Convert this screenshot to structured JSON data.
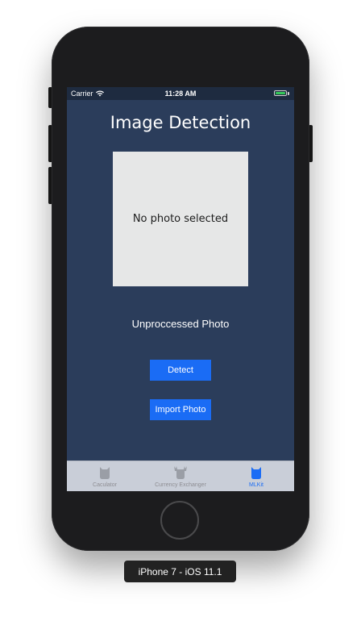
{
  "status_bar": {
    "carrier": "Carrier",
    "time": "11:28 AM",
    "battery_color": "#34c759"
  },
  "screen": {
    "title": "Image Detection",
    "photo_placeholder": "No photo selected",
    "status_text": "Unproccessed Photo",
    "detect_button": "Detect",
    "import_button": "Import Photo",
    "background_color": "#2b3d5b",
    "accent_color": "#1a6cf5"
  },
  "tab_bar": {
    "active_index": 2,
    "tabs": [
      {
        "label": "Caculator",
        "icon": "cat-icon"
      },
      {
        "label": "Currency Exchanger",
        "icon": "moose-icon"
      },
      {
        "label": "MLKit",
        "icon": "cat-icon"
      }
    ]
  },
  "device": {
    "label": "iPhone 7 - iOS 11.1"
  }
}
